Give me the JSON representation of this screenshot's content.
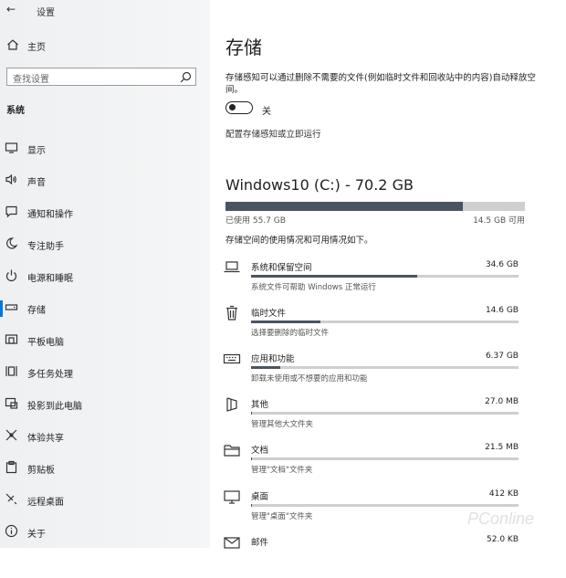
{
  "window": {
    "title": "设置"
  },
  "sidebar": {
    "home_label": "主页",
    "search_placeholder": "查找设置",
    "section_title": "系统",
    "items": [
      {
        "label": "显示",
        "icon": "display-icon"
      },
      {
        "label": "声音",
        "icon": "speaker-icon"
      },
      {
        "label": "通知和操作",
        "icon": "notification-icon"
      },
      {
        "label": "专注助手",
        "icon": "moon-icon"
      },
      {
        "label": "电源和睡眠",
        "icon": "power-icon"
      },
      {
        "label": "存储",
        "icon": "storage-icon",
        "active": true
      },
      {
        "label": "平板电脑",
        "icon": "tablet-icon"
      },
      {
        "label": "多任务处理",
        "icon": "multitask-icon"
      },
      {
        "label": "投影到此电脑",
        "icon": "project-icon"
      },
      {
        "label": "体验共享",
        "icon": "share-icon"
      },
      {
        "label": "剪贴板",
        "icon": "clipboard-icon"
      },
      {
        "label": "远程桌面",
        "icon": "remote-icon"
      },
      {
        "label": "关于",
        "icon": "info-icon"
      }
    ]
  },
  "main": {
    "title": "存储",
    "description": "存储感知可以通过删除不需要的文件(例如临时文件和回收站中的内容)自动释放空间。",
    "toggle_label": "关",
    "toggle_on": false,
    "config_link": "配置存储感知或立即运行",
    "drive": {
      "title": "Windows10 (C:) - 70.2 GB",
      "used_label": "已使用 55.7 GB",
      "available_label": "14.5 GB 可用",
      "used_fraction": 0.793
    },
    "usage_description": "存储空间的使用情况和可用情况如下。",
    "categories": [
      {
        "name": "系统和保留空间",
        "size": "34.6 GB",
        "sub": "系统文件可帮助 Windows 正常运行",
        "fraction": 0.62,
        "icon": "laptop-icon"
      },
      {
        "name": "临时文件",
        "size": "14.6 GB",
        "sub": "选择要删除的临时文件",
        "fraction": 0.26,
        "icon": "trash-icon"
      },
      {
        "name": "应用和功能",
        "size": "6.37 GB",
        "sub": "卸载未使用或不想要的应用和功能",
        "fraction": 0.11,
        "icon": "keyboard-icon"
      },
      {
        "name": "其他",
        "size": "27.0 MB",
        "sub": "管理其他大文件夹",
        "fraction": 0.004,
        "icon": "other-file-icon"
      },
      {
        "name": "文档",
        "size": "21.5 MB",
        "sub": "管理\"文档\"文件夹",
        "fraction": 0.003,
        "icon": "folder-icon"
      },
      {
        "name": "桌面",
        "size": "412 KB",
        "sub": "管理\"桌面\"文件夹",
        "fraction": 0.001,
        "icon": "monitor-icon"
      },
      {
        "name": "邮件",
        "size": "52.0 KB",
        "sub": "",
        "fraction": 0.0,
        "icon": "mail-icon"
      }
    ]
  },
  "watermark": "PConline"
}
